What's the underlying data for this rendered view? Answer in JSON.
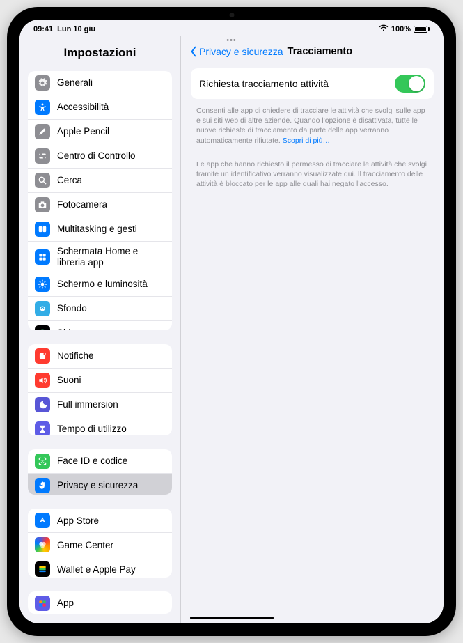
{
  "status": {
    "time": "09:41",
    "date": "Lun 10 giu",
    "battery_pct": "100%"
  },
  "sidebar": {
    "title": "Impostazioni",
    "group1": [
      {
        "label": "Generali",
        "icon": "gear",
        "cls": "g-gray"
      },
      {
        "label": "Accessibilità",
        "icon": "access",
        "cls": "g-blue"
      },
      {
        "label": "Apple Pencil",
        "icon": "pencil",
        "cls": "g-gray"
      },
      {
        "label": "Centro di Controllo",
        "icon": "switches",
        "cls": "g-gray"
      },
      {
        "label": "Cerca",
        "icon": "search",
        "cls": "g-gray"
      },
      {
        "label": "Fotocamera",
        "icon": "camera",
        "cls": "g-gray"
      },
      {
        "label": "Multitasking e gesti",
        "icon": "multitask",
        "cls": "g-blue"
      },
      {
        "label": "Schermata Home e libreria app",
        "icon": "home",
        "cls": "g-blue"
      },
      {
        "label": "Schermo e luminosità",
        "icon": "brightness",
        "cls": "g-blue"
      },
      {
        "label": "Sfondo",
        "icon": "wallpaper",
        "cls": "g-cyan"
      },
      {
        "label": "Siri",
        "icon": "siri",
        "cls": "g-black"
      }
    ],
    "group2": [
      {
        "label": "Notifiche",
        "icon": "bell",
        "cls": "g-red"
      },
      {
        "label": "Suoni",
        "icon": "speaker",
        "cls": "g-red"
      },
      {
        "label": "Full immersion",
        "icon": "moon",
        "cls": "g-purple"
      },
      {
        "label": "Tempo di utilizzo",
        "icon": "hourglass",
        "cls": "g-indigo"
      }
    ],
    "group3": [
      {
        "label": "Face ID e codice",
        "icon": "faceid",
        "cls": "g-green"
      },
      {
        "label": "Privacy e sicurezza",
        "icon": "hand",
        "cls": "g-blue",
        "selected": true
      }
    ],
    "group4": [
      {
        "label": "App Store",
        "icon": "appstore",
        "cls": "g-blue"
      },
      {
        "label": "Game Center",
        "icon": "gamecenter",
        "cls": "g-grad"
      },
      {
        "label": "Wallet e Apple Pay",
        "icon": "wallet",
        "cls": "g-black"
      }
    ],
    "group5": [
      {
        "label": "App",
        "icon": "apps",
        "cls": "g-indigo"
      }
    ]
  },
  "main": {
    "back_label": "Privacy e sicurezza",
    "title": "Tracciamento",
    "toggle_label": "Richiesta tracciamento attività",
    "footer1_a": "Consenti alle app di chiedere di tracciare le attività che svolgi sulle app e sui siti web di altre aziende. Quando l'opzione è disattivata, tutte le nuove richieste di tracciamento da parte delle app verranno automaticamente rifiutate. ",
    "footer1_link": "Scopri di più…",
    "footer2": "Le app che hanno richiesto il permesso di tracciare le attività che svolgi tramite un identificativo verranno visualizzate qui. Il tracciamento delle attività è bloccato per le app alle quali hai negato l'accesso."
  }
}
